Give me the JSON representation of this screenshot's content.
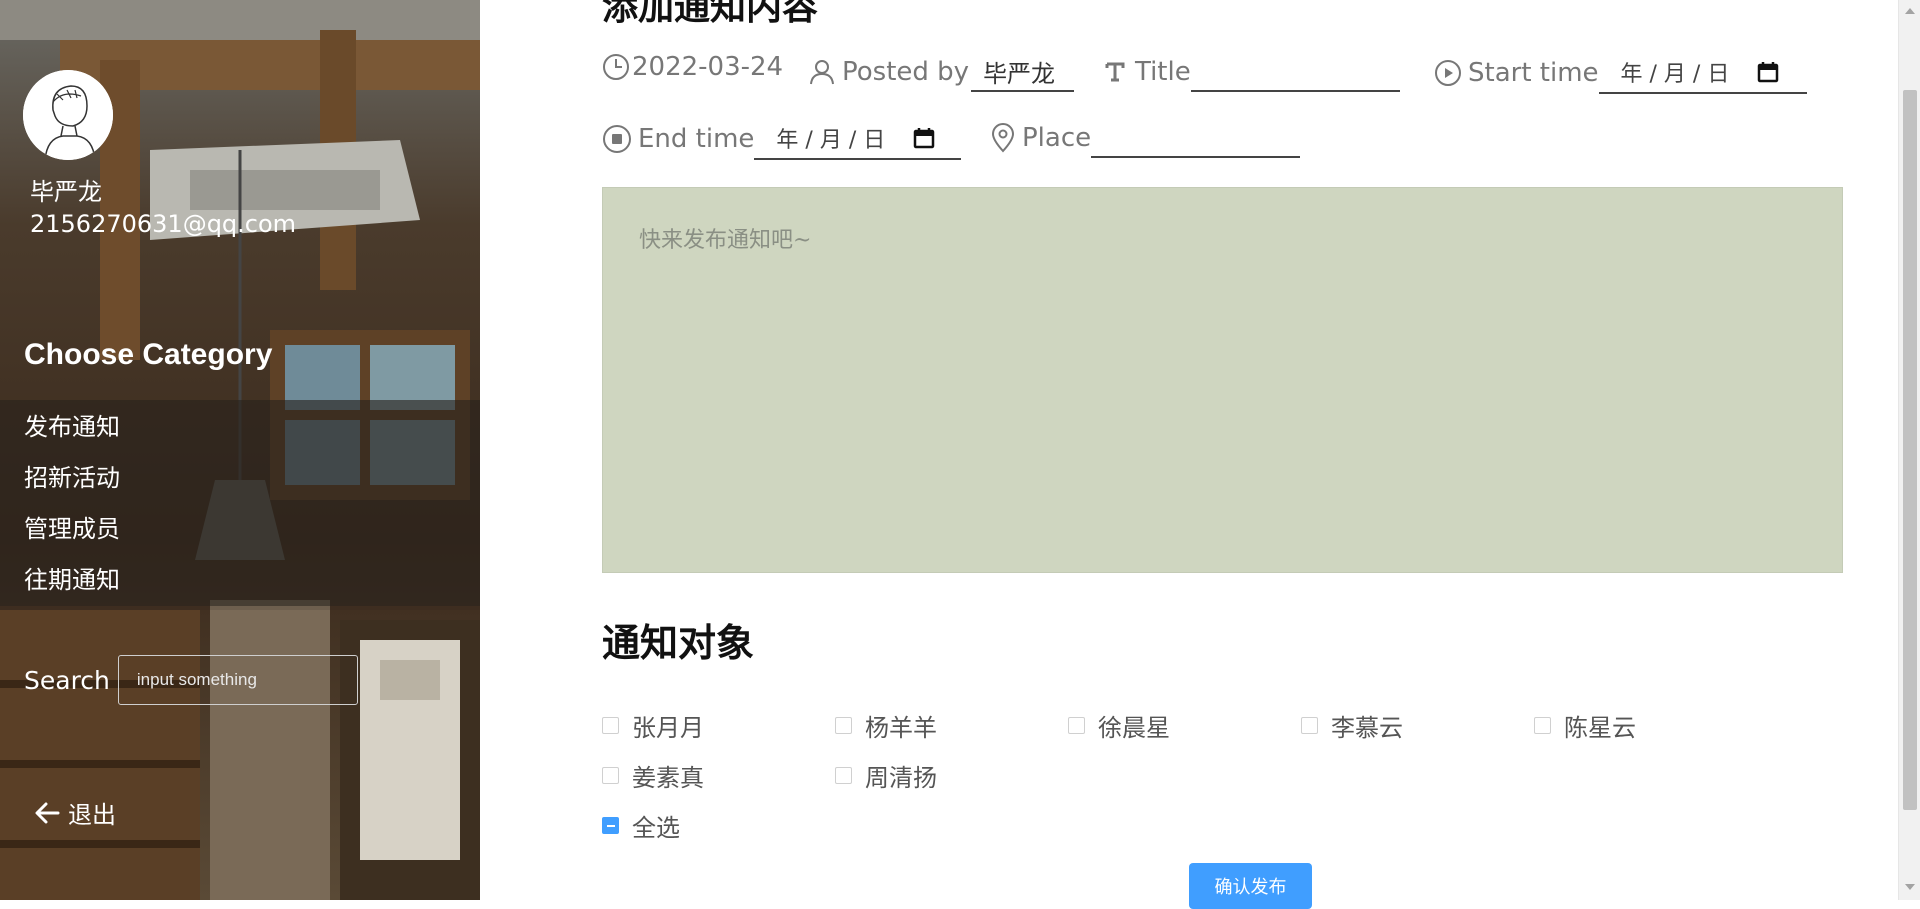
{
  "sidebar": {
    "user_name": "毕严龙",
    "user_email": "2156270631@qq.com",
    "category_title": "Choose Category",
    "menu": [
      {
        "label": "发布通知"
      },
      {
        "label": "招新活动"
      },
      {
        "label": "管理成员"
      },
      {
        "label": "往期通知"
      }
    ],
    "search_label": "Search",
    "search_placeholder": "input something",
    "logout_label": "退出"
  },
  "main": {
    "form_heading": "添加通知内容",
    "date_value": "2022-03-24",
    "posted_by_label": "Posted by",
    "posted_by_value": "毕严龙",
    "title_label": "Title",
    "title_value": "",
    "start_time_label": "Start time",
    "start_date_placeholder": "年 / 月 / 日",
    "end_time_label": "End time",
    "end_date_placeholder": "年 / 月 / 日",
    "place_label": "Place",
    "place_value": "",
    "content_placeholder": "快来发布通知吧~",
    "recipients_heading": "通知对象",
    "recipients": [
      {
        "name": "张月月",
        "checked": false
      },
      {
        "name": "杨羊羊",
        "checked": false
      },
      {
        "name": "徐晨星",
        "checked": false
      },
      {
        "name": "李慕云",
        "checked": false
      },
      {
        "name": "陈星云",
        "checked": false
      },
      {
        "name": "姜素真",
        "checked": false
      },
      {
        "name": "周清扬",
        "checked": false
      }
    ],
    "select_all_label": "全选",
    "select_all_state": "indeterminate",
    "confirm_label": "确认发布"
  },
  "colors": {
    "editor_bg": "#cfd6c0",
    "primary": "#409eff",
    "sidebar_overlay": "#3a2b20"
  }
}
